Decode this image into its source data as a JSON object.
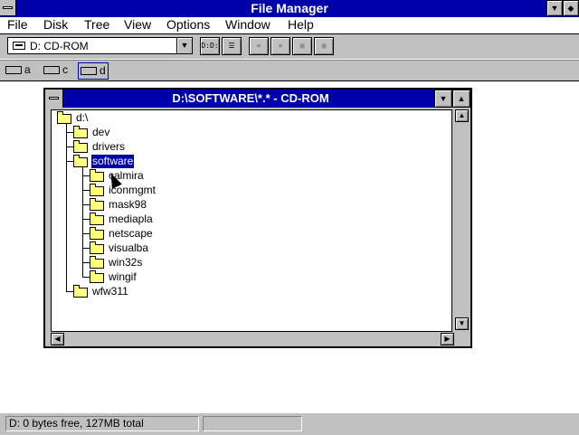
{
  "app": {
    "title": "File Manager"
  },
  "menu": {
    "items": [
      "File",
      "Disk",
      "Tree",
      "View",
      "Options",
      "Window",
      "Help"
    ]
  },
  "toolbar": {
    "drive_selected": "D: CD-ROM",
    "buttons": [
      "D:D:",
      "list",
      "sort",
      "sort2",
      "copy",
      "zoom"
    ]
  },
  "drives": [
    {
      "letter": "a",
      "type": "floppy"
    },
    {
      "letter": "c",
      "type": "hard-disk"
    },
    {
      "letter": "d",
      "type": "cd-rom",
      "selected": true
    }
  ],
  "child_window": {
    "title": "D:\\SOFTWARE\\*.* - CD-ROM"
  },
  "tree": {
    "root": "d:\\",
    "level1": [
      "dev",
      "drivers",
      "software",
      "wfw311"
    ],
    "selected": "software",
    "software_children": [
      "calmira",
      "iconmgmt",
      "mask98",
      "mediapla",
      "netscape",
      "visualba",
      "win32s",
      "wingif"
    ]
  },
  "status": {
    "left": "D: 0 bytes free,  127MB total",
    "right": ""
  },
  "colors": {
    "title_bar": "#0000a8",
    "chrome": "#c0c0c0",
    "folder": "#ffff80"
  }
}
